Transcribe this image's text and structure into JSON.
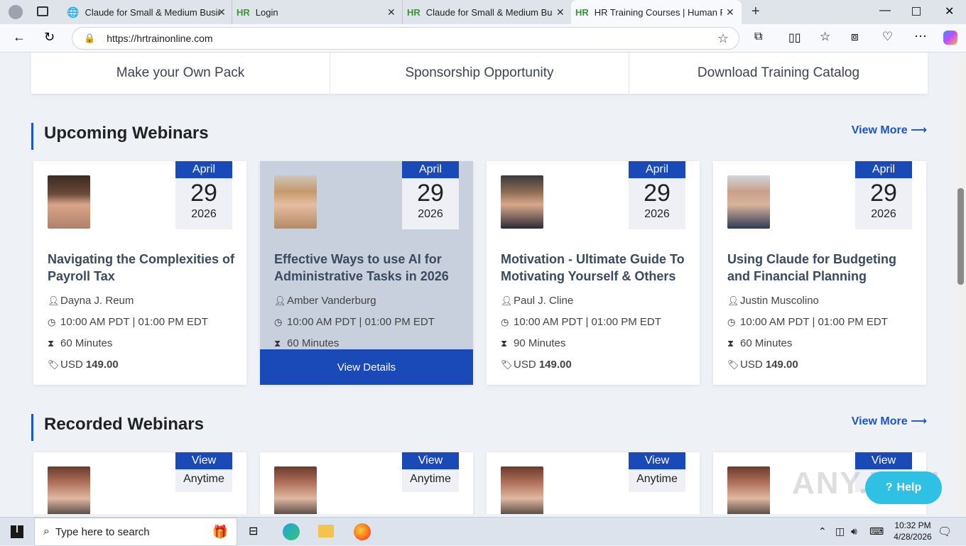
{
  "browser": {
    "tabs": [
      {
        "title": "Claude for Small & Medium Busin",
        "icon": "globe-icon"
      },
      {
        "title": "Login",
        "icon": "hr-favicon"
      },
      {
        "title": "Claude for Small & Medium Busin",
        "icon": "hr-favicon"
      },
      {
        "title": "HR Training Courses | Human Res",
        "icon": "hr-favicon",
        "active": true
      }
    ],
    "favicon_text": "HR",
    "url": "https://hrtrainonline.com"
  },
  "nav_strip": [
    "Make your Own Pack",
    "Sponsorship Opportunity",
    "Download Training Catalog"
  ],
  "upcoming": {
    "title": "Upcoming Webinars",
    "view_more": "View More",
    "cards": [
      {
        "month": "April",
        "day": "29",
        "year": "2026",
        "title": "Navigating the Complexities of Payroll Tax",
        "speaker": "Dayna J. Reum",
        "time": "10:00 AM PDT | 01:00 PM EDT",
        "duration": "60 Minutes",
        "currency": "USD",
        "price": "149.00"
      },
      {
        "month": "April",
        "day": "29",
        "year": "2026",
        "title": "Effective Ways to use AI for Administrative Tasks in 2026",
        "speaker": "Amber Vanderburg",
        "time": "10:00 AM PDT | 01:00 PM EDT",
        "duration": "60 Minutes",
        "currency": "USD",
        "price": "149.00",
        "button": "View Details"
      },
      {
        "month": "April",
        "day": "29",
        "year": "2026",
        "title": "Motivation - Ultimate Guide To Motivating Yourself & Others",
        "speaker": "Paul J. Cline",
        "time": "10:00 AM PDT | 01:00 PM EDT",
        "duration": "90 Minutes",
        "currency": "USD",
        "price": "149.00"
      },
      {
        "month": "April",
        "day": "29",
        "year": "2026",
        "title": "Using Claude for Budgeting and Financial Planning",
        "speaker": "Justin Muscolino",
        "time": "10:00 AM PDT | 01:00 PM EDT",
        "duration": "60 Minutes",
        "currency": "USD",
        "price": "149.00"
      }
    ]
  },
  "recorded": {
    "title": "Recorded Webinars",
    "view_more": "View More",
    "cards": [
      {
        "line1": "View",
        "line2": "Anytime"
      },
      {
        "line1": "View",
        "line2": "Anytime"
      },
      {
        "line1": "View",
        "line2": "Anytime"
      },
      {
        "line1": "View",
        "line2": "A"
      }
    ]
  },
  "help": "Help",
  "watermark": "ANY.RUN",
  "taskbar": {
    "search_placeholder": "Type here to search",
    "time": "10:32 PM",
    "date": "4/28/2026"
  }
}
